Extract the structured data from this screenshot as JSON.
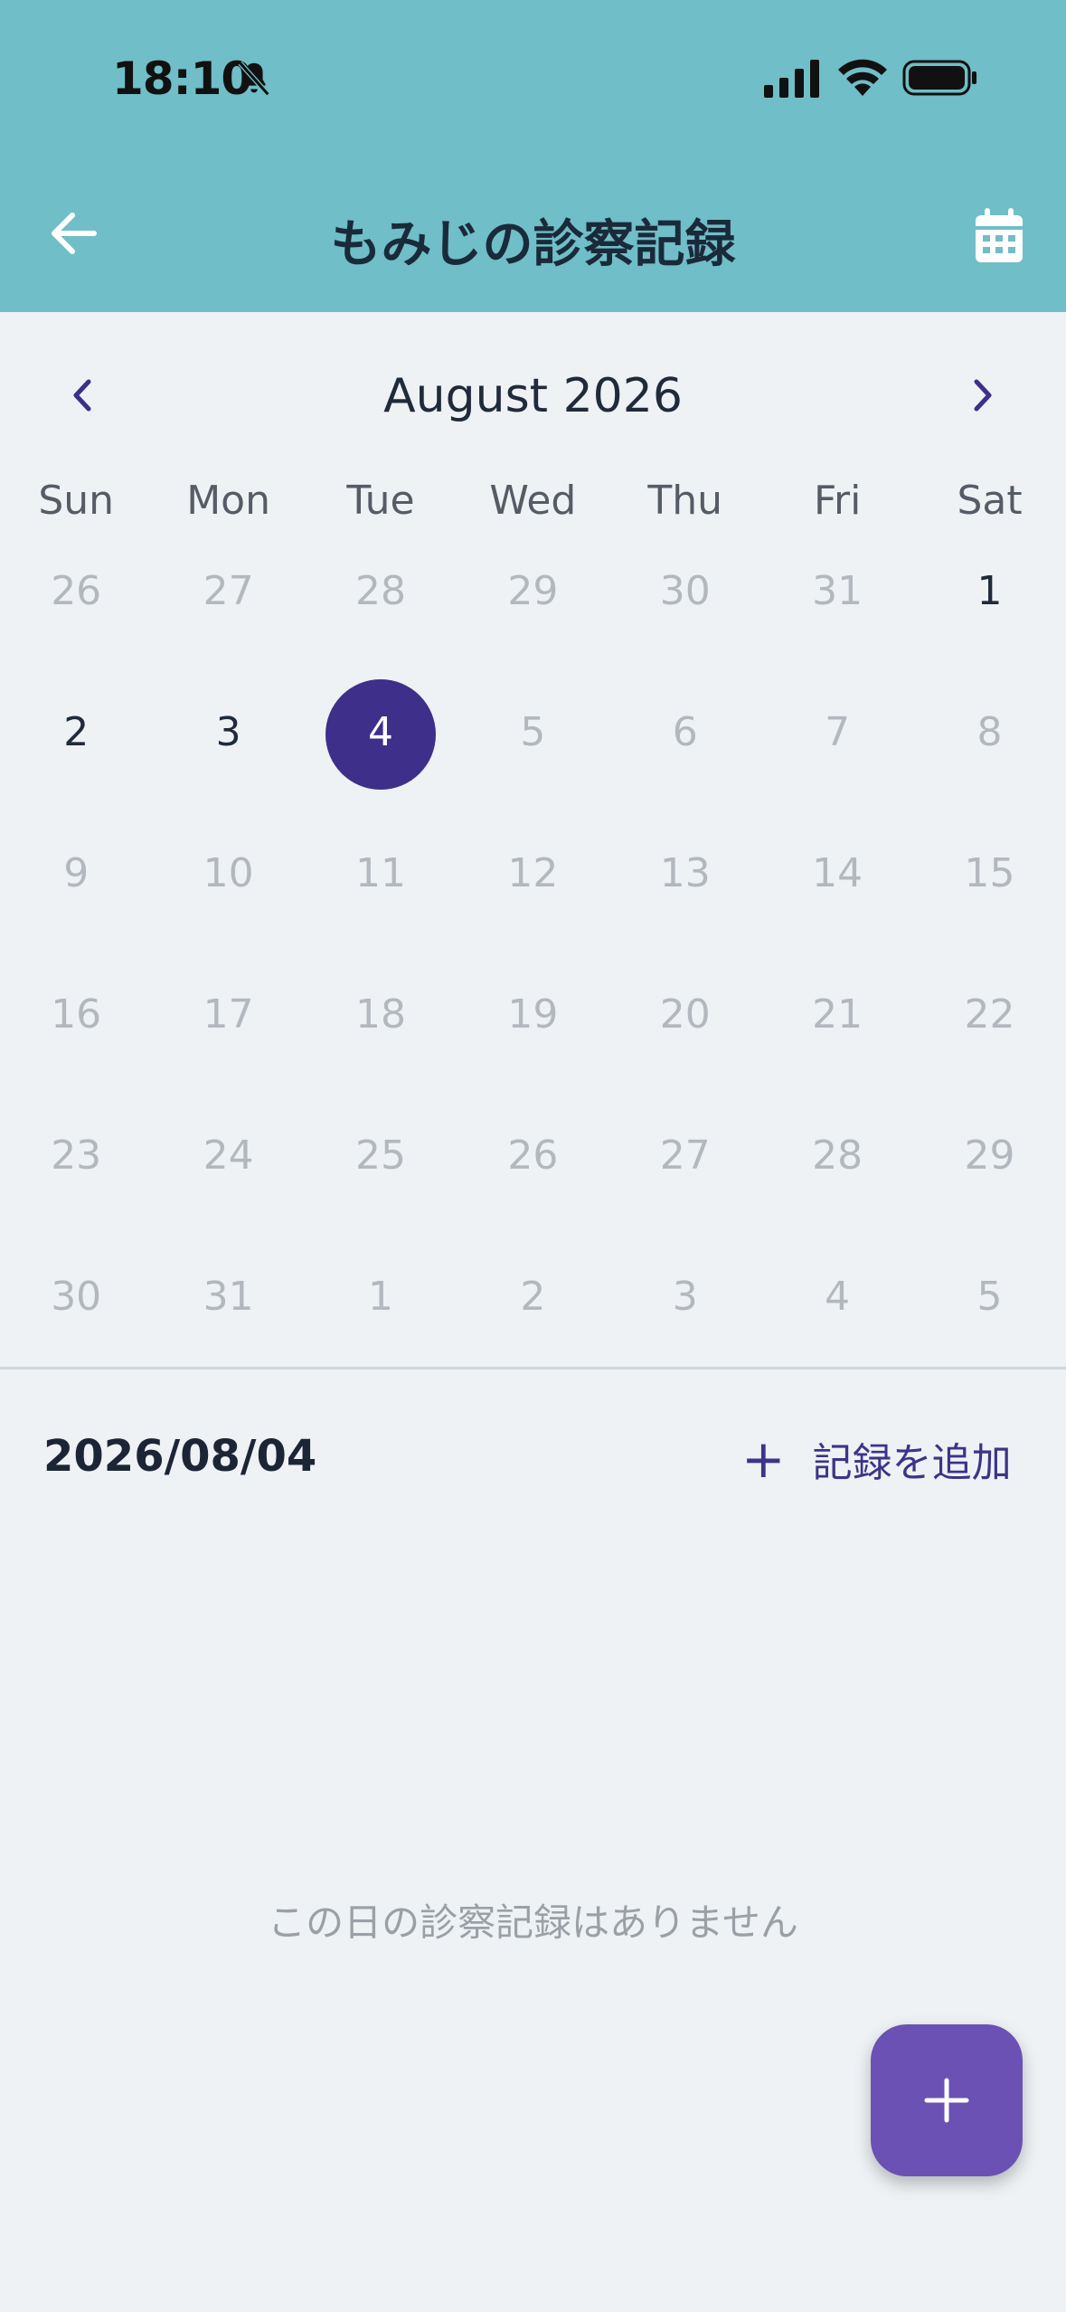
{
  "status_bar": {
    "time": "18:10"
  },
  "header": {
    "title": "もみじの診察記録"
  },
  "calendar": {
    "month_label": "August 2026",
    "weekdays": [
      "Sun",
      "Mon",
      "Tue",
      "Wed",
      "Thu",
      "Fri",
      "Sat"
    ],
    "weeks": [
      [
        "26",
        "27",
        "28",
        "29",
        "30",
        "31",
        "1"
      ],
      [
        "2",
        "3",
        "4",
        "5",
        "6",
        "7",
        "8"
      ],
      [
        "9",
        "10",
        "11",
        "12",
        "13",
        "14",
        "15"
      ],
      [
        "16",
        "17",
        "18",
        "19",
        "20",
        "21",
        "22"
      ],
      [
        "23",
        "24",
        "25",
        "26",
        "27",
        "28",
        "29"
      ],
      [
        "30",
        "31",
        "1",
        "2",
        "3",
        "4",
        "5"
      ]
    ],
    "active_days": [
      "1",
      "2",
      "3"
    ],
    "selected_day": "4"
  },
  "selected_date": "2026/08/04",
  "add_record_label": "記録を追加",
  "empty_message": "この日の診察記録はありません",
  "colors": {
    "header": "#70bec7",
    "selected": "#3e2f8a",
    "fab": "#6a51b3",
    "accent_text": "#3e3388"
  }
}
